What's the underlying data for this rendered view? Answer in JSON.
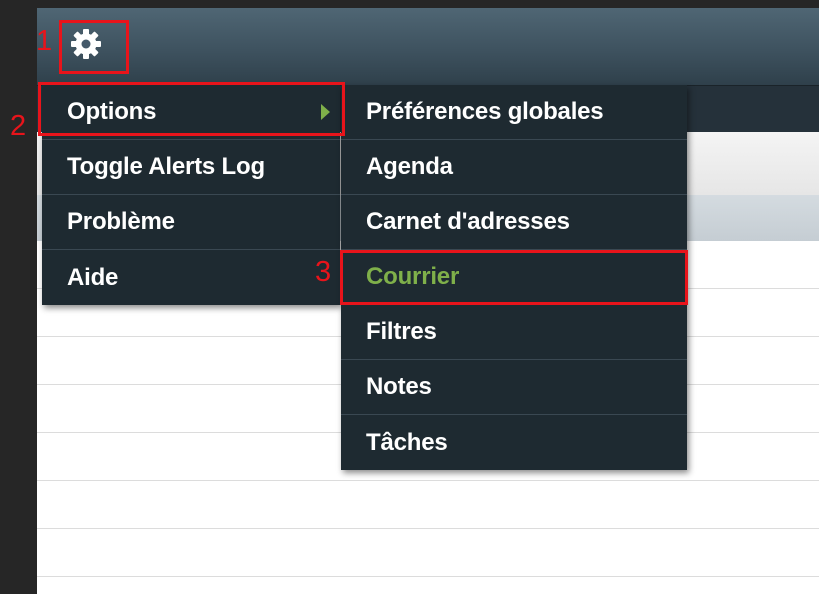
{
  "toolbar": {
    "settings_icon": "gear-icon"
  },
  "main_menu": {
    "items": [
      {
        "label": "Options",
        "has_submenu": true
      },
      {
        "label": "Toggle Alerts Log"
      },
      {
        "label": "Problème"
      },
      {
        "label": "Aide"
      }
    ]
  },
  "sub_menu": {
    "items": [
      {
        "label": "Préférences globales"
      },
      {
        "label": "Agenda"
      },
      {
        "label": "Carnet d'adresses"
      },
      {
        "label": "Courrier",
        "active": true
      },
      {
        "label": "Filtres"
      },
      {
        "label": "Notes"
      },
      {
        "label": "Tâches"
      }
    ]
  },
  "callouts": [
    "1",
    "2",
    "3"
  ],
  "colors": {
    "menu_bg": "#1e2a31",
    "active_item": "#7fb04a",
    "callout": "#e8141b",
    "header_bar": "#3e525f"
  }
}
